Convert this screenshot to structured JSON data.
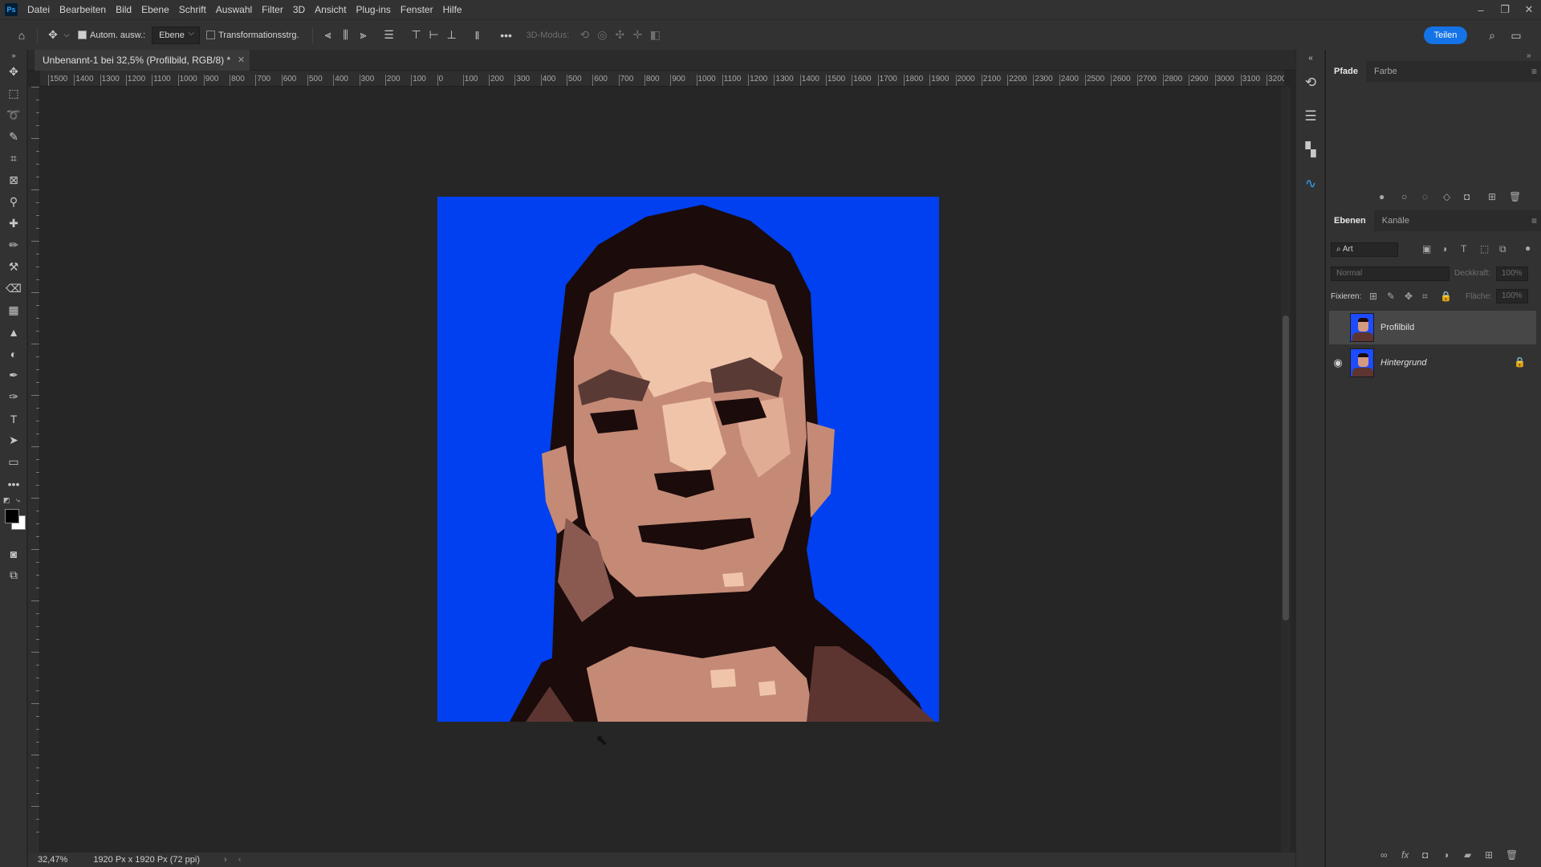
{
  "menubar": {
    "app_logo": "Ps",
    "items": [
      "Datei",
      "Bearbeiten",
      "Bild",
      "Ebene",
      "Schrift",
      "Auswahl",
      "Filter",
      "3D",
      "Ansicht",
      "Plug-ins",
      "Fenster",
      "Hilfe"
    ]
  },
  "optionsbar": {
    "auto_select_label": "Autom. ausw.:",
    "auto_select_value": "Ebene",
    "transform_label": "Transformationsstrg.",
    "mode_3d_label": "3D-Modus:",
    "share_label": "Teilen"
  },
  "document": {
    "tab_title": "Unbenannt-1 bei 32,5% (Profilbild, RGB/8) *"
  },
  "ruler": {
    "top_labels": [
      "1500",
      "1400",
      "1300",
      "1200",
      "1100",
      "1000",
      "900",
      "800",
      "700",
      "600",
      "500",
      "400",
      "300",
      "200",
      "100",
      "0",
      "100",
      "200",
      "300",
      "400",
      "500",
      "600",
      "700",
      "800",
      "900",
      "1000",
      "1100",
      "1200",
      "1300",
      "1400",
      "1500",
      "1600",
      "1700",
      "1800",
      "1900",
      "2000",
      "2100",
      "2200",
      "2300",
      "2400",
      "2500",
      "2600",
      "2700",
      "2800",
      "2900",
      "3000",
      "3100",
      "3200"
    ]
  },
  "statusbar": {
    "zoom": "32,47%",
    "doc_size": "1920 Px x 1920 Px (72 ppi)"
  },
  "panels": {
    "top_tabs": [
      "Pfade",
      "Farbe"
    ],
    "layer_tabs": [
      "Ebenen",
      "Kanäle"
    ],
    "filter_label": "Art",
    "blend_mode": "Normal",
    "opacity_label": "Deckkraft:",
    "opacity_value": "100%",
    "lock_label": "Fixieren:",
    "fill_label": "Fläche:",
    "fill_value": "100%",
    "layers": [
      {
        "name": "Profilbild",
        "visible": false,
        "selected": true
      },
      {
        "name": "Hintergrund",
        "visible": true,
        "selected": false,
        "locked": true
      }
    ]
  },
  "colors": {
    "accent": "#1473e6",
    "canvas_bg": "#0040f0",
    "hair": "#1b0b0b",
    "skin_light": "#f0c4a8",
    "skin_mid": "#c48a76",
    "skin_dark": "#8a5a50",
    "shirt": "#5c3530"
  }
}
